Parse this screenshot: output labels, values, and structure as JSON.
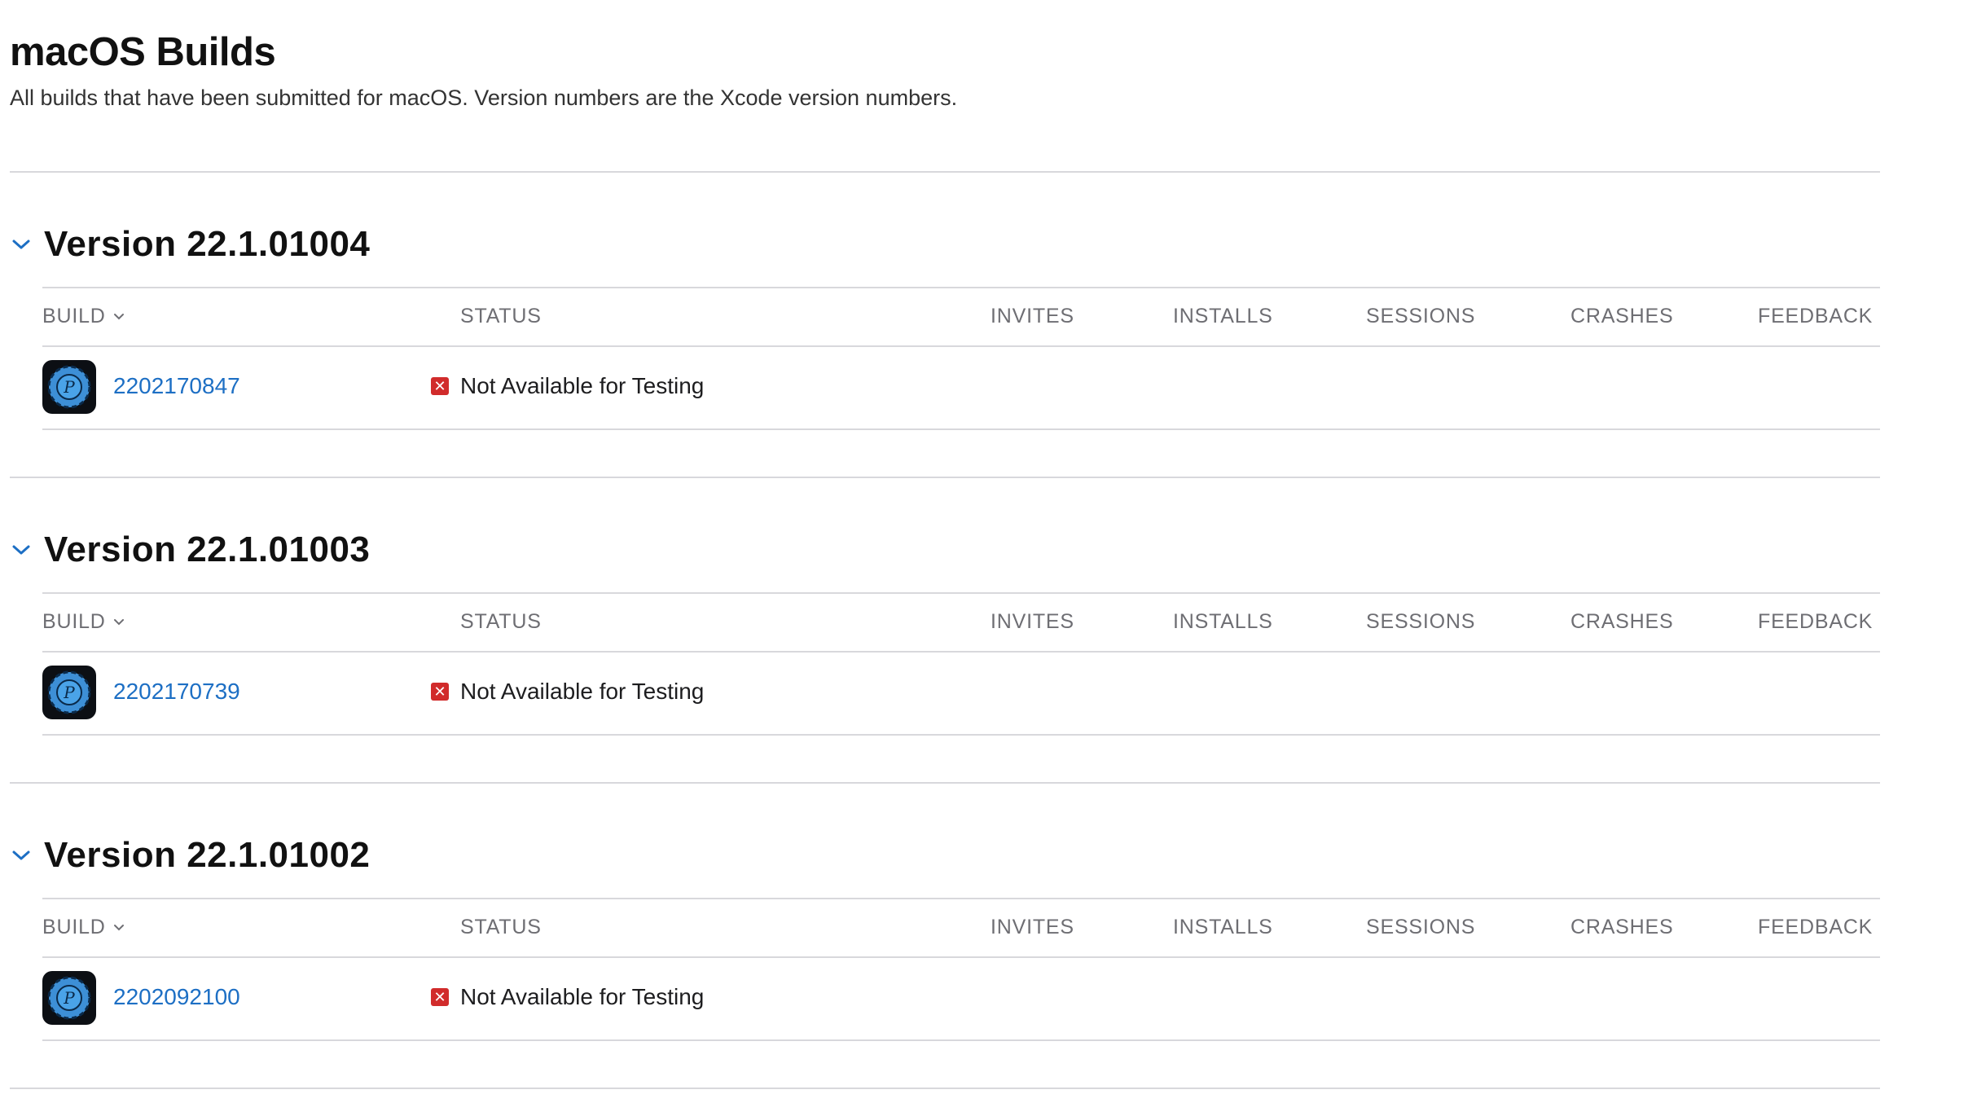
{
  "page": {
    "title": "macOS Builds",
    "subtitle": "All builds that have been submitted for macOS. Version numbers are the Xcode version numbers."
  },
  "table_headers": {
    "build": "BUILD",
    "status": "STATUS",
    "invites": "INVITES",
    "installs": "INSTALLS",
    "sessions": "SESSIONS",
    "crashes": "CRASHES",
    "feedback": "FEEDBACK"
  },
  "icons": {
    "expand": "chevron-down-icon",
    "sort": "chevron-down-icon",
    "status": "x-mark-icon",
    "app": "app-icon"
  },
  "colors": {
    "link": "#1d6fc4",
    "status_error": "#d12b2b",
    "divider": "#d8d8dc",
    "header_text": "#6e6e73"
  },
  "versions": [
    {
      "title": "Version 22.1.01004",
      "builds": [
        {
          "number": "2202170847",
          "status": "Not Available for Testing"
        }
      ]
    },
    {
      "title": "Version 22.1.01003",
      "builds": [
        {
          "number": "2202170739",
          "status": "Not Available for Testing"
        }
      ]
    },
    {
      "title": "Version 22.1.01002",
      "builds": [
        {
          "number": "2202092100",
          "status": "Not Available for Testing"
        }
      ]
    }
  ]
}
